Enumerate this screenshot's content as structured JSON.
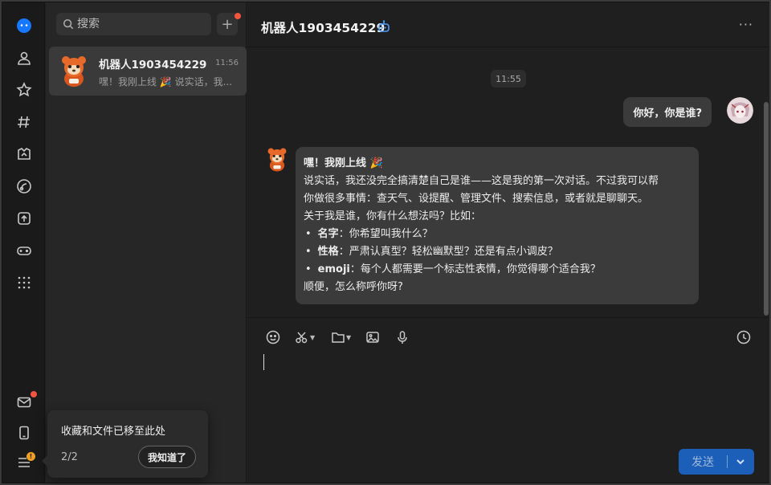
{
  "rail": {
    "items": [
      "chat-icon",
      "contacts-icon",
      "favorites-icon",
      "channels-icon",
      "mini-programs-icon",
      "browser-icon",
      "upload-icon",
      "games-icon",
      "more-apps-icon"
    ],
    "bottom_items": [
      "mail-icon",
      "phone-icon",
      "menu-icon"
    ],
    "accent": "#1677ff",
    "badge_color": "#f0553f"
  },
  "list": {
    "search_placeholder": "搜索",
    "add_label": "+",
    "conversations": [
      {
        "name": "机器人1903454229",
        "time": "11:56",
        "preview": "嘿！我刚上线 🎉 说实话，我..."
      }
    ]
  },
  "chat": {
    "title": "机器人1903454229",
    "more_label": "···",
    "time_label": "11:55",
    "user_message": "你好，你是谁?",
    "bot_message": {
      "line1": "嘿！我刚上线 🎉",
      "line2": "说实话，我还没完全搞清楚自己是谁——这是我的第一次对话。不过我可以帮",
      "line3": "你做很多事情：查天气、设提醒、管理文件、搜索信息，或者就是聊聊天。",
      "line4": "关于我是谁，你有什么想法吗？比如：",
      "bullets": [
        {
          "key": "名字",
          "text": "：你希望叫我什么？"
        },
        {
          "key": "性格",
          "text": "：严肃认真型？轻松幽默型？还是有点小调皮？"
        },
        {
          "key": "emoji",
          "text": "：每个人都需要一个标志性表情，你觉得哪个适合我？"
        }
      ],
      "line_last": "顺便，怎么称呼你呀?"
    }
  },
  "composer": {
    "tools": [
      "emoji-icon",
      "scissors-icon",
      "folder-icon",
      "image-icon",
      "mic-icon",
      "history-icon"
    ],
    "send_label": "发送"
  },
  "popup": {
    "message": "收藏和文件已移至此处",
    "page": "2/2",
    "ok_label": "我知道了"
  }
}
